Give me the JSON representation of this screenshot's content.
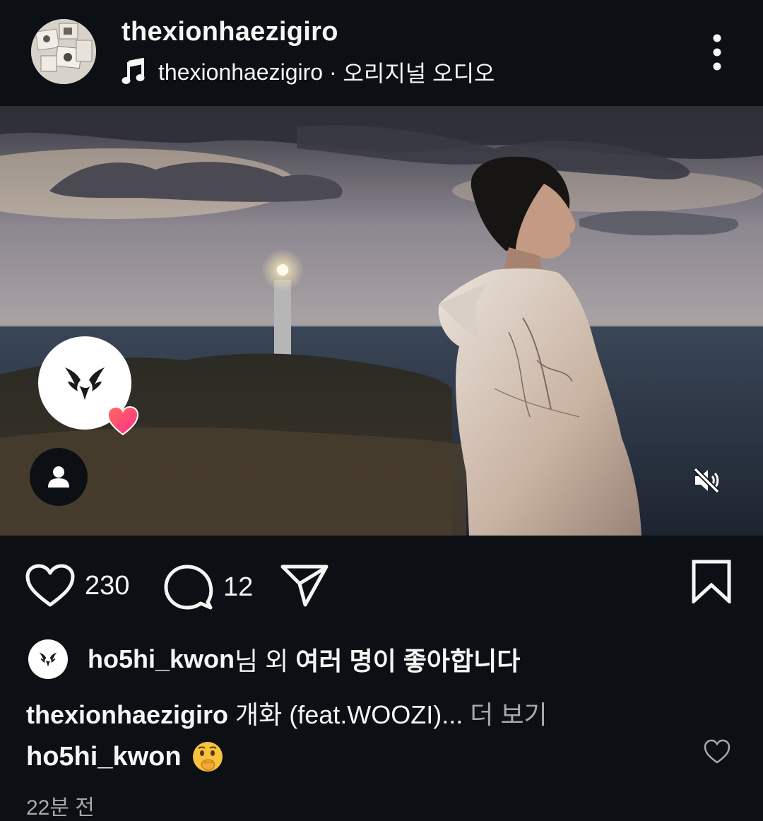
{
  "post": {
    "username": "thexionhaezigiro",
    "audio_owner": "thexionhaezigiro",
    "audio_separator": " · ",
    "audio_label": "오리지널 오디오"
  },
  "actions": {
    "like_count": "230",
    "comment_count": "12"
  },
  "likes": {
    "first_user": "ho5hi_kwon",
    "suffix_1": "님 외 ",
    "suffix_2": "여러 명이 좋아합니다"
  },
  "caption": {
    "username": "thexionhaezigiro",
    "text": " 개화 (feat.WOOZI)...",
    "more_label": " 더 보기"
  },
  "comment": {
    "username": "ho5hi_kwon",
    "emoji": "shushing-face-icon"
  },
  "timestamp": "22분 전",
  "colors": {
    "background": "#0c1014",
    "text": "#f5f5f5",
    "secondary_text": "#a8a8a8",
    "heart_badge": "#ff3b7f"
  }
}
